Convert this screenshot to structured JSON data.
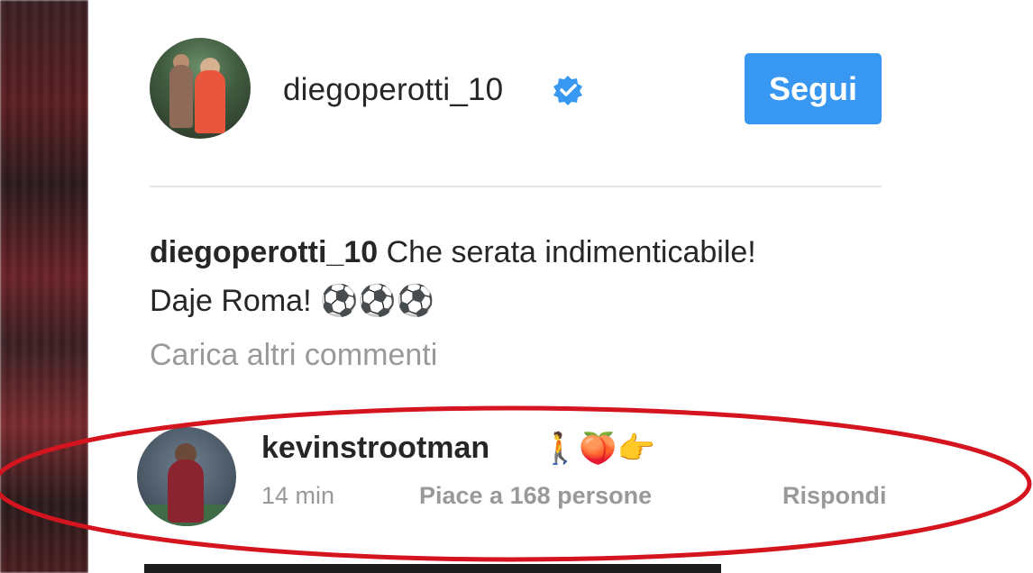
{
  "post_header": {
    "username": "diegoperotti_10",
    "verified_icon": "verified-badge-icon",
    "follow_button_label": "Segui"
  },
  "caption": {
    "username": "diegoperotti_10",
    "text_line1": "Che serata indimenticabile!",
    "text_line2": "Daje Roma! ⚽⚽⚽"
  },
  "load_more_label": "Carica altri commenti",
  "comment": {
    "username": "kevinstrootman",
    "emojis": "🚶🍑👉",
    "time": "14 min",
    "likes": "Piace a 168 persone",
    "reply_label": "Rispondi"
  },
  "colors": {
    "accent": "#3897f0",
    "text": "#262626",
    "muted": "#999999",
    "highlight": "#d4141f"
  }
}
